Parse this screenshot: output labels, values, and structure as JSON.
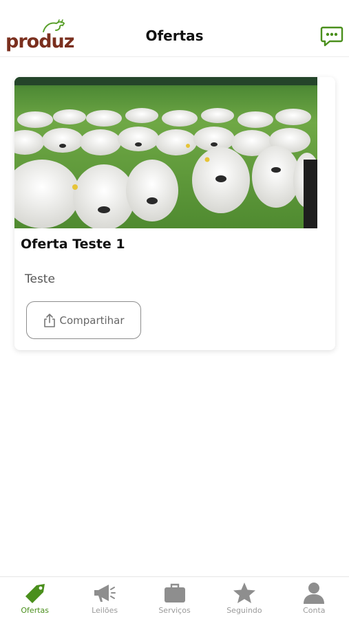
{
  "app": {
    "logo_text": "produz"
  },
  "header": {
    "title": "Ofertas",
    "chat_icon": "chat-bubble-icon"
  },
  "offer": {
    "title": "Oferta Teste 1",
    "description": "Teste",
    "share_label": "Compartihar",
    "image_desc": "herd-of-white-cattle-photo"
  },
  "nav": {
    "items": [
      {
        "label": "Ofertas",
        "icon": "tag-icon",
        "active": true
      },
      {
        "label": "Leilões",
        "icon": "megaphone-icon",
        "active": false
      },
      {
        "label": "Serviços",
        "icon": "briefcase-icon",
        "active": false
      },
      {
        "label": "Seguindo",
        "icon": "star-icon",
        "active": false
      },
      {
        "label": "Conta",
        "icon": "user-icon",
        "active": false
      }
    ]
  },
  "colors": {
    "brand_green": "#4a8f1c",
    "logo_brown": "#7a2f1e",
    "inactive_gray": "#9a9a9a"
  }
}
